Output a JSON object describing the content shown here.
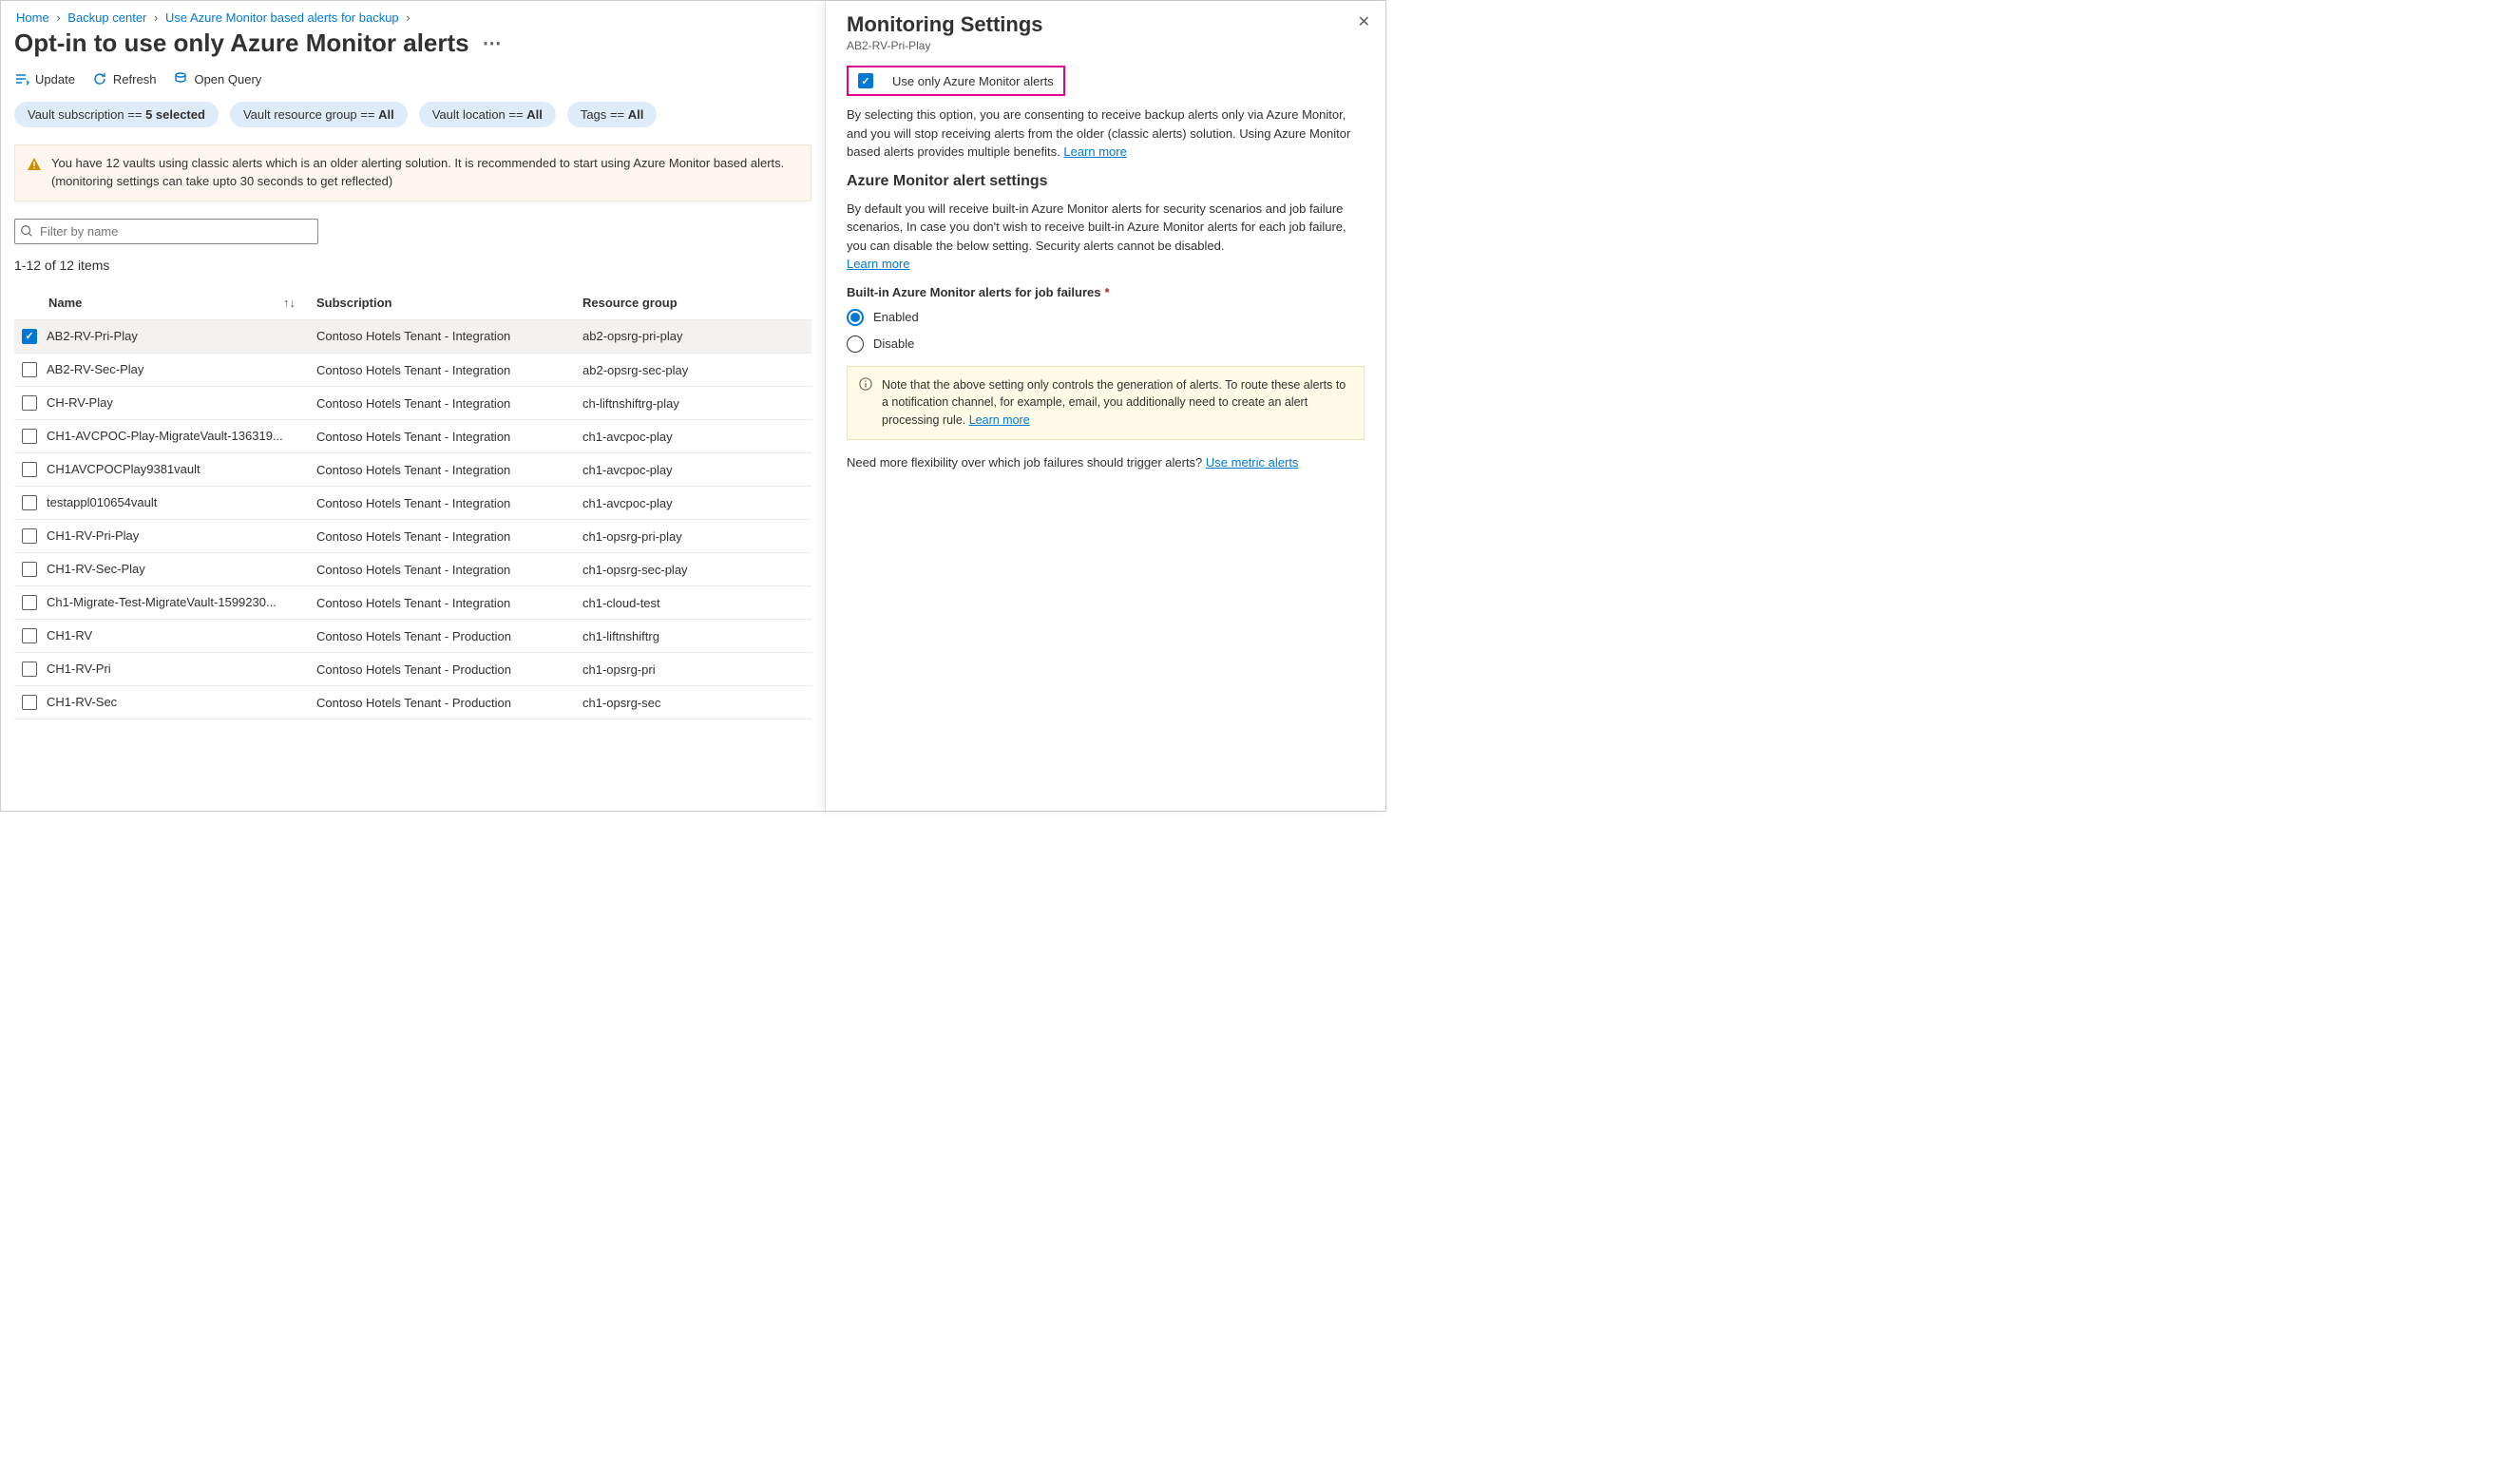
{
  "breadcrumbs": {
    "home": "Home",
    "backup_center": "Backup center",
    "use_alerts": "Use Azure Monitor based alerts for backup"
  },
  "page_title": "Opt-in to use only Azure Monitor alerts",
  "toolbar": {
    "update": "Update",
    "refresh": "Refresh",
    "open_query": "Open Query"
  },
  "pills": {
    "subscription_prefix": "Vault subscription == ",
    "subscription_value": "5 selected",
    "rg_prefix": "Vault resource group == ",
    "rg_value": "All",
    "location_prefix": "Vault location == ",
    "location_value": "All",
    "tags_prefix": "Tags == ",
    "tags_value": "All"
  },
  "warning_text": "You have 12 vaults using classic alerts which is an older alerting solution. It is recommended to start using Azure Monitor based alerts. (monitoring settings can take upto 30 seconds to get reflected)",
  "filter_placeholder": "Filter by name",
  "item_count": "1-12 of 12 items",
  "columns": {
    "name": "Name",
    "subscription": "Subscription",
    "rg": "Resource group"
  },
  "rows": [
    {
      "checked": true,
      "name": "AB2-RV-Pri-Play",
      "sub": "Contoso Hotels Tenant - Integration",
      "rg": "ab2-opsrg-pri-play"
    },
    {
      "checked": false,
      "name": "AB2-RV-Sec-Play",
      "sub": "Contoso Hotels Tenant - Integration",
      "rg": "ab2-opsrg-sec-play"
    },
    {
      "checked": false,
      "name": "CH-RV-Play",
      "sub": "Contoso Hotels Tenant - Integration",
      "rg": "ch-liftnshiftrg-play"
    },
    {
      "checked": false,
      "name": "CH1-AVCPOC-Play-MigrateVault-136319...",
      "sub": "Contoso Hotels Tenant - Integration",
      "rg": "ch1-avcpoc-play"
    },
    {
      "checked": false,
      "name": "CH1AVCPOCPlay9381vault",
      "sub": "Contoso Hotels Tenant - Integration",
      "rg": "ch1-avcpoc-play"
    },
    {
      "checked": false,
      "name": "testappl010654vault",
      "sub": "Contoso Hotels Tenant - Integration",
      "rg": "ch1-avcpoc-play"
    },
    {
      "checked": false,
      "name": "CH1-RV-Pri-Play",
      "sub": "Contoso Hotels Tenant - Integration",
      "rg": "ch1-opsrg-pri-play"
    },
    {
      "checked": false,
      "name": "CH1-RV-Sec-Play",
      "sub": "Contoso Hotels Tenant - Integration",
      "rg": "ch1-opsrg-sec-play"
    },
    {
      "checked": false,
      "name": "Ch1-Migrate-Test-MigrateVault-1599230...",
      "sub": "Contoso Hotels Tenant - Integration",
      "rg": "ch1-cloud-test"
    },
    {
      "checked": false,
      "name": "CH1-RV",
      "sub": "Contoso Hotels Tenant - Production",
      "rg": "ch1-liftnshiftrg"
    },
    {
      "checked": false,
      "name": "CH1-RV-Pri",
      "sub": "Contoso Hotels Tenant - Production",
      "rg": "ch1-opsrg-pri"
    },
    {
      "checked": false,
      "name": "CH1-RV-Sec",
      "sub": "Contoso Hotels Tenant - Production",
      "rg": "ch1-opsrg-sec"
    }
  ],
  "side": {
    "title": "Monitoring Settings",
    "subtitle": "AB2-RV-Pri-Play",
    "checkbox_label": "Use only Azure Monitor alerts",
    "desc1": "By selecting this option, you are consenting to receive backup alerts only via Azure Monitor, and you will stop receiving alerts from the older (classic alerts) solution. Using Azure Monitor based alerts provides multiple benefits. ",
    "learn_more": "Learn more",
    "h_settings": "Azure Monitor alert settings",
    "desc2": "By default you will receive built-in Azure Monitor alerts for security scenarios and job failure scenarios, In case you don't wish to receive built-in Azure Monitor alerts for each job failure, you can disable the below setting. Security alerts cannot be disabled. ",
    "field_label": "Built-in Azure Monitor alerts for job failures",
    "radio_enabled": "Enabled",
    "radio_disable": "Disable",
    "info_text": "Note that the above setting only controls the generation of alerts. To route these alerts to a notification channel, for example, email, you additionally need to create an alert processing rule.  ",
    "flex_text": "Need more flexibility over which job failures should trigger alerts? ",
    "use_metric": "Use metric alerts"
  }
}
